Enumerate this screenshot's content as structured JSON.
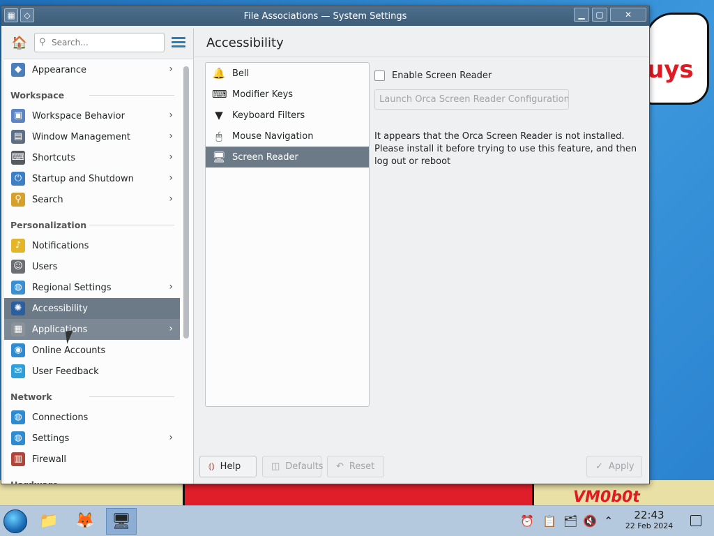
{
  "window": {
    "title": "File Associations — System Settings"
  },
  "sidebar": {
    "search_placeholder": "Search...",
    "items": [
      {
        "type": "item",
        "label": "Appearance",
        "icon": "appearance-icon",
        "color": "#4a7fb8",
        "chevron": true
      },
      {
        "type": "section",
        "label": "Workspace"
      },
      {
        "type": "item",
        "label": "Workspace Behavior",
        "icon": "workspace-behavior-icon",
        "color": "#5b84c4",
        "chevron": true
      },
      {
        "type": "item",
        "label": "Window Management",
        "icon": "window-management-icon",
        "color": "#5c6f86",
        "chevron": true
      },
      {
        "type": "item",
        "label": "Shortcuts",
        "icon": "keyboard-icon",
        "color": "#555b61",
        "chevron": true
      },
      {
        "type": "item",
        "label": "Startup and Shutdown",
        "icon": "startup-icon",
        "color": "#3d7fc4",
        "chevron": true
      },
      {
        "type": "item",
        "label": "Search",
        "icon": "search-icon",
        "color": "#d6a12b",
        "chevron": true
      },
      {
        "type": "section",
        "label": "Personalization"
      },
      {
        "type": "item",
        "label": "Notifications",
        "icon": "bell-icon",
        "color": "#e3b528",
        "chevron": false
      },
      {
        "type": "item",
        "label": "Users",
        "icon": "users-icon",
        "color": "#6b6e72",
        "chevron": false
      },
      {
        "type": "item",
        "label": "Regional Settings",
        "icon": "globe-icon",
        "color": "#3a8fd0",
        "chevron": true
      },
      {
        "type": "item",
        "label": "Accessibility",
        "icon": "accessibility-icon",
        "color": "#2b5e9c",
        "chevron": false,
        "state": "selected"
      },
      {
        "type": "item",
        "label": "Applications",
        "icon": "applications-icon",
        "color": "#8a9199",
        "chevron": true,
        "state": "hover"
      },
      {
        "type": "item",
        "label": "Online Accounts",
        "icon": "online-accounts-icon",
        "color": "#2e8bd1",
        "chevron": false
      },
      {
        "type": "item",
        "label": "User Feedback",
        "icon": "user-feedback-icon",
        "color": "#2e9fd8",
        "chevron": false
      },
      {
        "type": "section",
        "label": "Network"
      },
      {
        "type": "item",
        "label": "Connections",
        "icon": "connections-icon",
        "color": "#2e8bd1",
        "chevron": false
      },
      {
        "type": "item",
        "label": "Settings",
        "icon": "network-settings-icon",
        "color": "#2e8bd1",
        "chevron": true
      },
      {
        "type": "item",
        "label": "Firewall",
        "icon": "firewall-icon",
        "color": "#b0463a",
        "chevron": false
      },
      {
        "type": "section",
        "label": "Hardware"
      }
    ]
  },
  "main": {
    "title": "Accessibility",
    "categories": [
      {
        "label": "Bell",
        "icon": "bell-icon",
        "glyph": "🔔"
      },
      {
        "label": "Modifier Keys",
        "icon": "modifier-keys-icon",
        "glyph": "⌨"
      },
      {
        "label": "Keyboard Filters",
        "icon": "filter-icon",
        "glyph": "▼"
      },
      {
        "label": "Mouse Navigation",
        "icon": "mouse-icon",
        "glyph": "🖱"
      },
      {
        "label": "Screen Reader",
        "icon": "screen-reader-icon",
        "glyph": "🖥",
        "selected": true
      }
    ],
    "screen_reader": {
      "enable_label": "Enable Screen Reader",
      "enabled": false,
      "launch_button": "Launch Orca Screen Reader Configuration...",
      "info": "It appears that the Orca Screen Reader is not installed. Please install it before trying to use this feature, and then log out or reboot"
    },
    "buttons": {
      "help": "Help",
      "defaults": "Defaults",
      "reset": "Reset",
      "apply": "Apply"
    }
  },
  "taskbar": {
    "time": "22:43",
    "date": "22 Feb 2024"
  },
  "wallpaper": {
    "cloud_text": "uys",
    "watermark": "VM0b0t"
  }
}
